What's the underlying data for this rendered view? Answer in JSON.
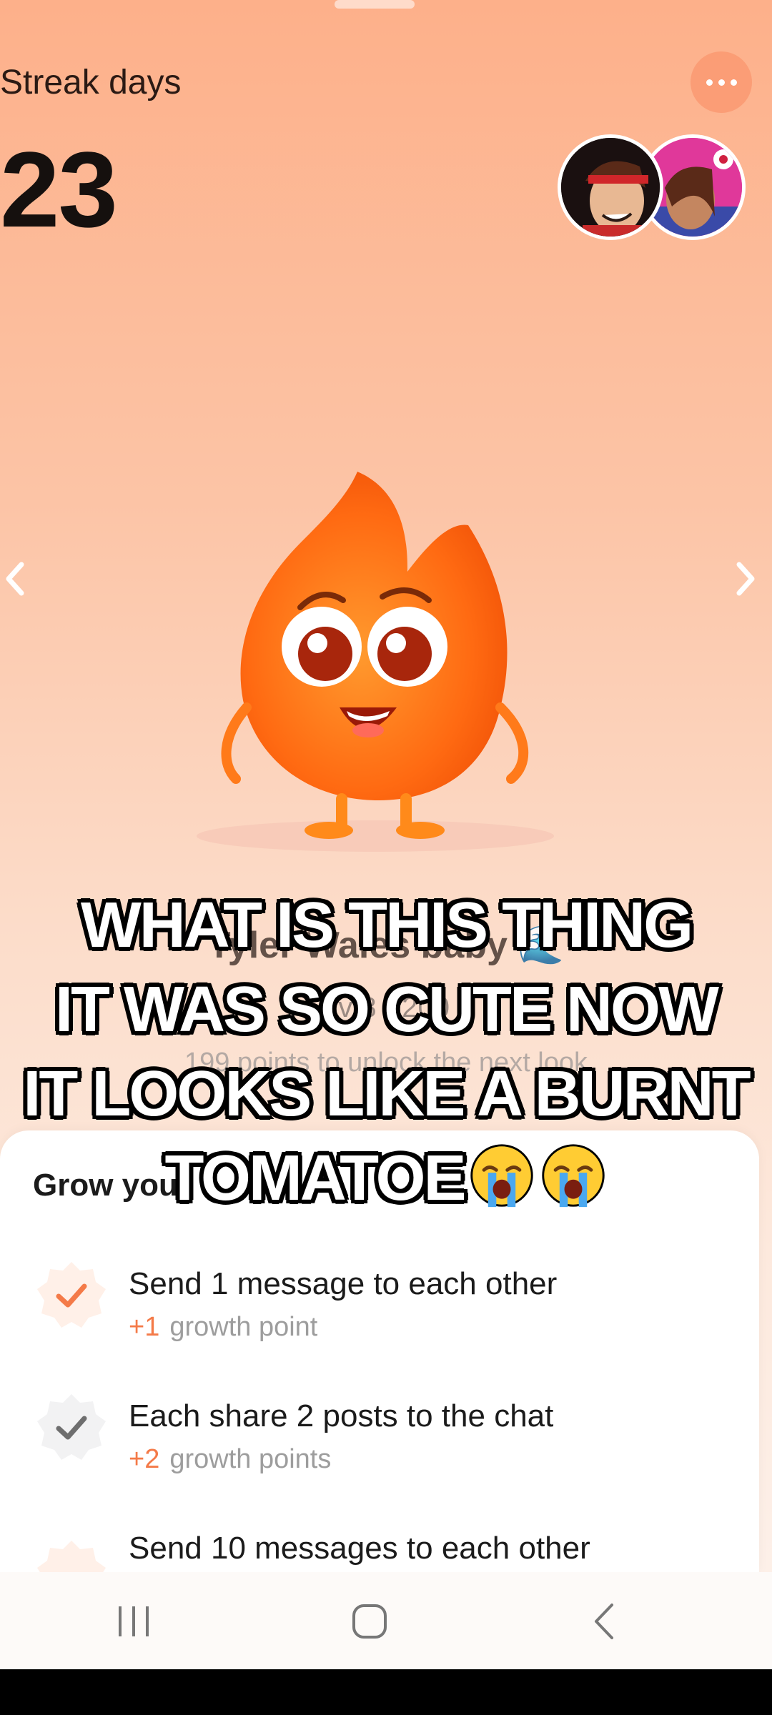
{
  "streak": {
    "label": "Streak days",
    "count": "23"
  },
  "companion": {
    "name": "Tyler Wales baby 🌊",
    "level": "Lv 8 · 200",
    "unlock_text": "199 points to unlock the next look"
  },
  "caption": {
    "lines": [
      "WHAT IS THIS THING",
      "IT WAS SO CUTE NOW",
      "IT LOOKS LIKE A BURNT",
      "TOMATOE"
    ]
  },
  "grow_card": {
    "title": "Grow your",
    "tasks": [
      {
        "title": "Send 1 message to each other",
        "plus": "+1",
        "points_label": "growth point",
        "status": "done-orange"
      },
      {
        "title": "Each share 2 posts to the chat",
        "plus": "+2",
        "points_label": "growth points",
        "status": "done-gray"
      },
      {
        "title": "Send 10 messages to each other",
        "plus": "",
        "points_label": "",
        "status": "partial"
      }
    ]
  },
  "icons": {
    "more": "more-options-icon",
    "prev": "chevron-left-icon",
    "next": "chevron-right-icon",
    "nav_recents": "recents-icon",
    "nav_home": "home-icon",
    "nav_back": "back-icon",
    "emoji": "loudly-crying-face-emoji"
  },
  "colors": {
    "accent": "#f47a48",
    "background_top": "#fdb08a",
    "background_bottom": "#fdf2ec"
  }
}
